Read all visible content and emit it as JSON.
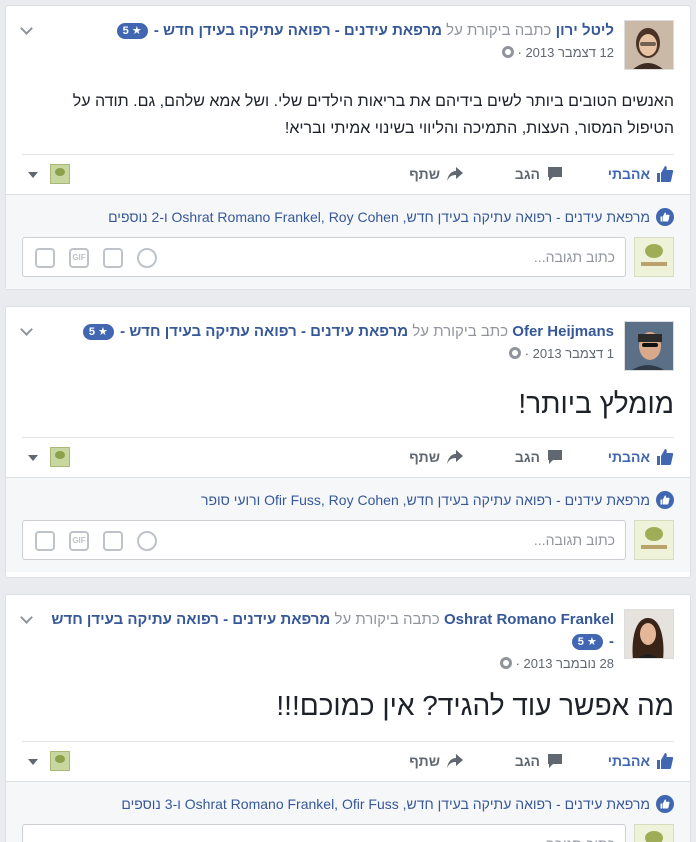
{
  "posts": [
    {
      "author": "ליטל ירון",
      "verb": "כתבה ביקורת על",
      "page": "מרפאת עידנים - רפואה עתיקה בעידן חדש -",
      "rating": "5 ★",
      "date": "12 דצמבר 2013 ·",
      "text": "האנשים הטובים ביותר לשים בידיהם את בריאות הילדים שלי. ושל אמא שלהם, גם. תודה על הטיפול המסור, העצות, התמיכה והליווי בשינוי אמיתי ובריא!",
      "reactions": "מרפאת עידנים - רפואה עתיקה בעידן חדש, Oshrat Romano Frankel, Roy Cohen ו-2 נוספים"
    },
    {
      "author": "Ofer Heijmans",
      "verb": "כתב ביקורת על",
      "page": "מרפאת עידנים - רפואה עתיקה בעידן חדש -",
      "rating": "5 ★",
      "date": "1 דצמבר 2013 ·",
      "text": "מומלץ ביותר!",
      "reactions": "מרפאת עידנים - רפואה עתיקה בעידן חדש, Ofir Fuss, Roy Cohen ורועי סופר"
    },
    {
      "author": "Oshrat Romano Frankel",
      "verb": "כתבה ביקורת על",
      "page": "מרפאת עידנים - רפואה עתיקה בעידן חדש -",
      "rating": "5 ★",
      "date": "28 נובמבר 2013 ·",
      "text": "מה אפשר עוד להגיד? אין כמוכם!!!",
      "reactions": "מרפאת עידנים - רפואה עתיקה בעידן חדש, Oshrat Romano Frankel, Ofir Fuss ו-3 נוספים"
    }
  ],
  "actions": {
    "like": "אהבתי",
    "comment": "הגב",
    "share": "שתף"
  },
  "comment_placeholder": "כתוב תגובה...",
  "colors": {
    "link": "#365899",
    "like_blue": "#4267b2",
    "background": "#e9ebee"
  },
  "icons": [
    "thumbs-up-icon",
    "comment-icon",
    "share-arrow-icon",
    "globe-icon",
    "sticker-icon",
    "gif-icon",
    "camera-icon",
    "emoji-icon",
    "chevron-down-icon"
  ]
}
